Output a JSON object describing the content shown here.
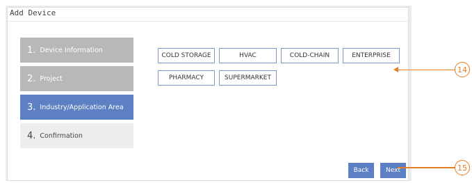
{
  "window": {
    "title": "Add Device"
  },
  "steps": [
    {
      "num": "1.",
      "label": "Device Information",
      "state": "done"
    },
    {
      "num": "2.",
      "label": "Project",
      "state": "done"
    },
    {
      "num": "3.",
      "label": "Industry/Application Area",
      "state": "active"
    },
    {
      "num": "4.",
      "label": "Confirmation",
      "state": "todo"
    }
  ],
  "areas": [
    "COLD STORAGE",
    "HVAC",
    "COLD-CHAIN",
    "ENTERPRISE",
    "PHARMACY",
    "SUPERMARKET"
  ],
  "buttons": {
    "back": "Back",
    "next": "Next"
  },
  "callouts": {
    "areas": "14",
    "next": "15"
  },
  "colors": {
    "accent": "#5d7fc4",
    "step_done": "#b8b8b8",
    "callout": "#e67e22"
  }
}
